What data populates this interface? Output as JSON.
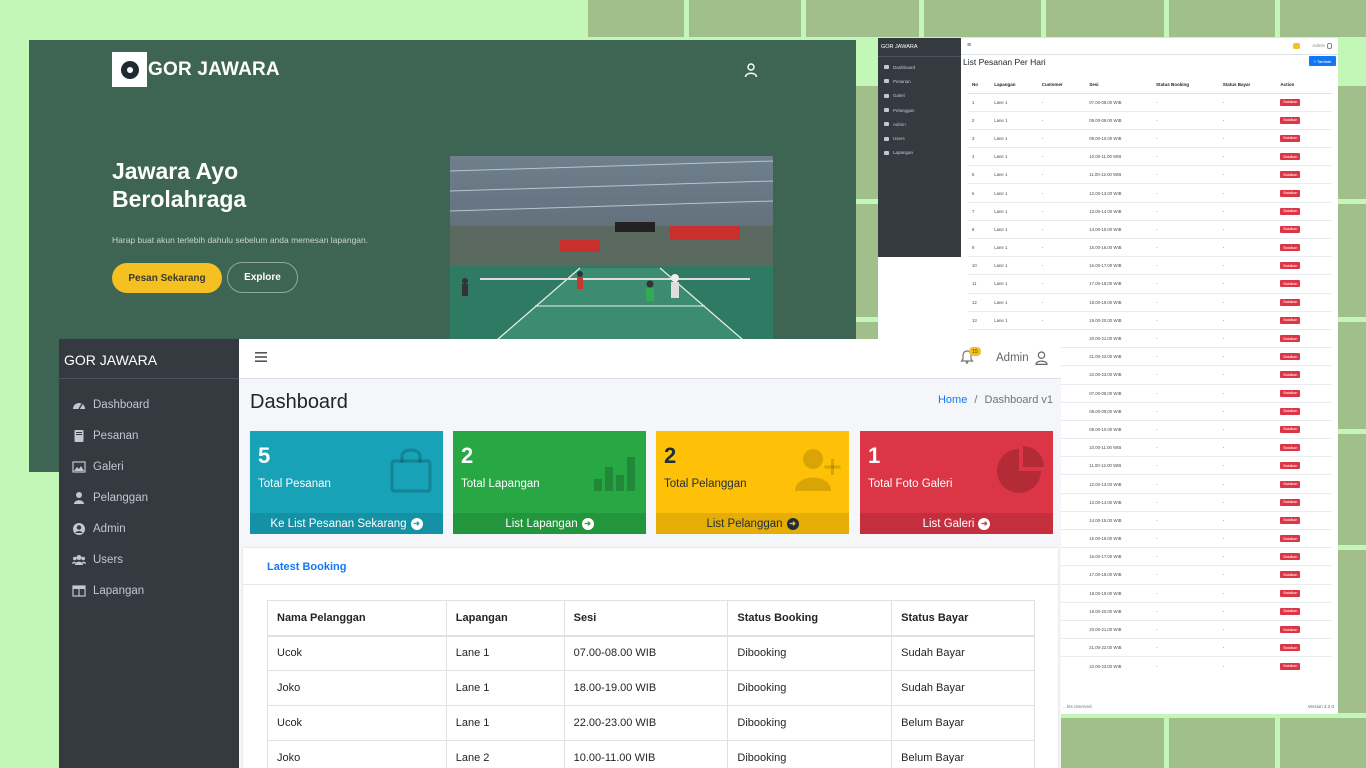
{
  "landing": {
    "brand": "GOR JAWARA",
    "headline": "Jawara Ayo Berolahraga",
    "subtitle": "Harap buat akun terlebih dahulu sebelum anda memesan lapangan.",
    "primary_button": "Pesan Sekarang",
    "secondary_button": "Explore",
    "colors": {
      "background": "#3e6553",
      "accent": "#f5c022"
    }
  },
  "list_window": {
    "brand": "GOR JAWARA",
    "sidebar": [
      "Dashboard",
      "Pesanan",
      "Galeri",
      "Pelanggan",
      "Admin",
      "Users",
      "Lapangan"
    ],
    "admin_label": "Admin",
    "title": "List Pesanan Per Hari",
    "add_button": "+ Tambah",
    "columns": [
      "No",
      "Lapangan",
      "Customer",
      "Sesi",
      "Status Booking",
      "Status Bayar",
      "Action"
    ],
    "rows": [
      {
        "no": "1",
        "lapangan": "Lane 1",
        "customer": "-",
        "sesi": "07.00-08.00 WIB",
        "status_booking": "-",
        "status_bayar": "-",
        "action": "Batalkan"
      },
      {
        "no": "2",
        "lapangan": "Lane 1",
        "customer": "-",
        "sesi": "08.00-09.00 WIB",
        "status_booking": "-",
        "status_bayar": "-",
        "action": "Batalkan"
      },
      {
        "no": "3",
        "lapangan": "Lane 1",
        "customer": "-",
        "sesi": "09.00-10.00 WIB",
        "status_booking": "-",
        "status_bayar": "-",
        "action": "Batalkan"
      },
      {
        "no": "4",
        "lapangan": "Lane 1",
        "customer": "-",
        "sesi": "10.00-11.00 WIB",
        "status_booking": "-",
        "status_bayar": "-",
        "action": "Batalkan"
      },
      {
        "no": "5",
        "lapangan": "Lane 1",
        "customer": "-",
        "sesi": "11.00-12.00 WIB",
        "status_booking": "-",
        "status_bayar": "-",
        "action": "Batalkan"
      },
      {
        "no": "6",
        "lapangan": "Lane 1",
        "customer": "-",
        "sesi": "12.00-13.00 WIB",
        "status_booking": "-",
        "status_bayar": "-",
        "action": "Batalkan"
      },
      {
        "no": "7",
        "lapangan": "Lane 1",
        "customer": "-",
        "sesi": "13.00-14.00 WIB",
        "status_booking": "-",
        "status_bayar": "-",
        "action": "Batalkan"
      },
      {
        "no": "8",
        "lapangan": "Lane 1",
        "customer": "-",
        "sesi": "14.00-15.00 WIB",
        "status_booking": "-",
        "status_bayar": "-",
        "action": "Batalkan"
      },
      {
        "no": "9",
        "lapangan": "Lane 1",
        "customer": "-",
        "sesi": "15.00-16.00 WIB",
        "status_booking": "-",
        "status_bayar": "-",
        "action": "Batalkan"
      },
      {
        "no": "10",
        "lapangan": "Lane 1",
        "customer": "-",
        "sesi": "16.00-17.00 WIB",
        "status_booking": "-",
        "status_bayar": "-",
        "action": "Batalkan"
      },
      {
        "no": "11",
        "lapangan": "Lane 1",
        "customer": "-",
        "sesi": "17.00-18.00 WIB",
        "status_booking": "-",
        "status_bayar": "-",
        "action": "Batalkan"
      },
      {
        "no": "12",
        "lapangan": "Lane 1",
        "customer": "-",
        "sesi": "18.00-19.00 WIB",
        "status_booking": "-",
        "status_bayar": "-",
        "action": "Batalkan"
      },
      {
        "no": "13",
        "lapangan": "Lane 1",
        "customer": "-",
        "sesi": "19.00-20.00 WIB",
        "status_booking": "-",
        "status_bayar": "-",
        "action": "Batalkan"
      },
      {
        "no": "",
        "lapangan": "",
        "customer": "",
        "sesi": "20.00-21.00 WIB",
        "status_booking": "-",
        "status_bayar": "-",
        "action": "Batalkan"
      },
      {
        "no": "",
        "lapangan": "",
        "customer": "",
        "sesi": "21.00-22.00 WIB",
        "status_booking": "-",
        "status_bayar": "-",
        "action": "Batalkan"
      },
      {
        "no": "",
        "lapangan": "",
        "customer": "",
        "sesi": "22.00-23.00 WIB",
        "status_booking": "-",
        "status_bayar": "-",
        "action": "Batalkan"
      },
      {
        "no": "",
        "lapangan": "",
        "customer": "",
        "sesi": "07.00-08.00 WIB",
        "status_booking": "-",
        "status_bayar": "-",
        "action": "Batalkan"
      },
      {
        "no": "",
        "lapangan": "",
        "customer": "",
        "sesi": "08.00-09.00 WIB",
        "status_booking": "-",
        "status_bayar": "-",
        "action": "Batalkan"
      },
      {
        "no": "",
        "lapangan": "",
        "customer": "",
        "sesi": "09.00-10.00 WIB",
        "status_booking": "-",
        "status_bayar": "-",
        "action": "Batalkan"
      },
      {
        "no": "",
        "lapangan": "",
        "customer": "",
        "sesi": "10.00-11.00 WIB",
        "status_booking": "-",
        "status_bayar": "-",
        "action": "Batalkan"
      },
      {
        "no": "",
        "lapangan": "",
        "customer": "",
        "sesi": "11.00-12.00 WIB",
        "status_booking": "-",
        "status_bayar": "-",
        "action": "Batalkan"
      },
      {
        "no": "",
        "lapangan": "",
        "customer": "",
        "sesi": "12.00-13.00 WIB",
        "status_booking": "-",
        "status_bayar": "-",
        "action": "Batalkan"
      },
      {
        "no": "",
        "lapangan": "",
        "customer": "",
        "sesi": "13.00-14.00 WIB",
        "status_booking": "-",
        "status_bayar": "-",
        "action": "Batalkan"
      },
      {
        "no": "",
        "lapangan": "",
        "customer": "",
        "sesi": "14.00-15.00 WIB",
        "status_booking": "-",
        "status_bayar": "-",
        "action": "Batalkan"
      },
      {
        "no": "",
        "lapangan": "",
        "customer": "",
        "sesi": "15.00-16.00 WIB",
        "status_booking": "-",
        "status_bayar": "-",
        "action": "Batalkan"
      },
      {
        "no": "",
        "lapangan": "",
        "customer": "",
        "sesi": "16.00-17.00 WIB",
        "status_booking": "-",
        "status_bayar": "-",
        "action": "Batalkan"
      },
      {
        "no": "",
        "lapangan": "",
        "customer": "",
        "sesi": "17.00-18.00 WIB",
        "status_booking": "-",
        "status_bayar": "-",
        "action": "Batalkan"
      },
      {
        "no": "",
        "lapangan": "",
        "customer": "",
        "sesi": "18.00-19.00 WIB",
        "status_booking": "-",
        "status_bayar": "-",
        "action": "Batalkan"
      },
      {
        "no": "",
        "lapangan": "",
        "customer": "",
        "sesi": "19.00-20.00 WIB",
        "status_booking": "-",
        "status_bayar": "-",
        "action": "Batalkan"
      },
      {
        "no": "",
        "lapangan": "",
        "customer": "",
        "sesi": "20.00-21.00 WIB",
        "status_booking": "-",
        "status_bayar": "-",
        "action": "Batalkan"
      },
      {
        "no": "",
        "lapangan": "",
        "customer": "",
        "sesi": "21.00-22.00 WIB",
        "status_booking": "-",
        "status_bayar": "-",
        "action": "Batalkan"
      },
      {
        "no": "",
        "lapangan": "",
        "customer": "",
        "sesi": "22.00-23.00 WIB",
        "status_booking": "-",
        "status_bayar": "-",
        "action": "Batalkan"
      }
    ],
    "footer_left": "...hts reserved.",
    "footer_right": "Version 3.2.0"
  },
  "dashboard": {
    "brand": "GOR JAWARA",
    "sidebar": [
      {
        "label": "Dashboard",
        "icon": "tachometer-icon"
      },
      {
        "label": "Pesanan",
        "icon": "book-icon"
      },
      {
        "label": "Galeri",
        "icon": "image-icon"
      },
      {
        "label": "Pelanggan",
        "icon": "user-icon"
      },
      {
        "label": "Admin",
        "icon": "user-circle-icon"
      },
      {
        "label": "Users",
        "icon": "users-icon"
      },
      {
        "label": "Lapangan",
        "icon": "table-icon"
      }
    ],
    "notification_count": "15",
    "admin_label": "Admin",
    "page_title": "Dashboard",
    "breadcrumb": {
      "home": "Home",
      "separator": "/",
      "current": "Dashboard v1"
    },
    "boxes": [
      {
        "value": "5",
        "label": "Total Pesanan",
        "link": "Ke List Pesanan Sekarang",
        "color": "#17a2b8",
        "icon": "shopping-bag-icon"
      },
      {
        "value": "2",
        "label": "Total Lapangan",
        "link": "List Lapangan",
        "color": "#28a745",
        "icon": "bar-chart-icon"
      },
      {
        "value": "2",
        "label": "Total Pelanggan",
        "link": "List Pelanggan",
        "color": "#ffc107",
        "icon": "user-plus-icon"
      },
      {
        "value": "1",
        "label": "Total Foto Galeri",
        "link": "List Galeri",
        "color": "#dc3545",
        "icon": "pie-chart-icon"
      }
    ],
    "latest_booking": {
      "title": "Latest Booking",
      "columns": [
        "Nama Pelanggan",
        "Lapangan",
        "Sesi",
        "Status Booking",
        "Status Bayar"
      ],
      "rows": [
        [
          "Ucok",
          "Lane 1",
          "07.00-08.00 WIB",
          "Dibooking",
          "Sudah Bayar"
        ],
        [
          "Joko",
          "Lane 1",
          "18.00-19.00 WIB",
          "Dibooking",
          "Sudah Bayar"
        ],
        [
          "Ucok",
          "Lane 1",
          "22.00-23.00 WIB",
          "Dibooking",
          "Belum Bayar"
        ],
        [
          "Joko",
          "Lane 2",
          "10.00-11.00 WIB",
          "Dibooking",
          "Belum Bayar"
        ]
      ]
    }
  }
}
